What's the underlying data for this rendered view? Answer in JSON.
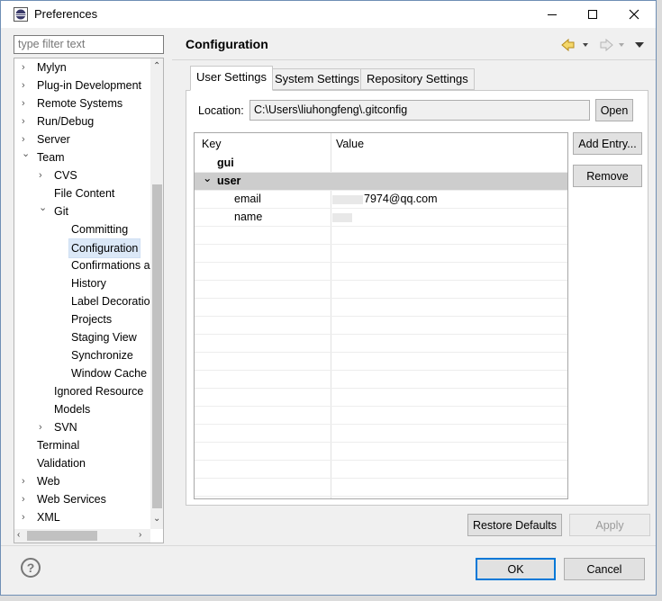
{
  "window": {
    "title": "Preferences"
  },
  "filter": {
    "placeholder": "type filter text"
  },
  "tree": {
    "items": [
      {
        "label": "Mylyn",
        "level": 0,
        "arrow": "collapsed"
      },
      {
        "label": "Plug-in Development",
        "level": 0,
        "arrow": "collapsed"
      },
      {
        "label": "Remote Systems",
        "level": 0,
        "arrow": "collapsed"
      },
      {
        "label": "Run/Debug",
        "level": 0,
        "arrow": "collapsed"
      },
      {
        "label": "Server",
        "level": 0,
        "arrow": "collapsed"
      },
      {
        "label": "Team",
        "level": 0,
        "arrow": "expanded"
      },
      {
        "label": "CVS",
        "level": 1,
        "arrow": "collapsed"
      },
      {
        "label": "File Content",
        "level": 1,
        "arrow": "none"
      },
      {
        "label": "Git",
        "level": 1,
        "arrow": "expanded"
      },
      {
        "label": "Committing",
        "level": 2,
        "arrow": "none"
      },
      {
        "label": "Configuration",
        "level": 2,
        "arrow": "none",
        "selected": true
      },
      {
        "label": "Confirmations a",
        "level": 2,
        "arrow": "none"
      },
      {
        "label": "History",
        "level": 2,
        "arrow": "none"
      },
      {
        "label": "Label Decoratio",
        "level": 2,
        "arrow": "none"
      },
      {
        "label": "Projects",
        "level": 2,
        "arrow": "none"
      },
      {
        "label": "Staging View",
        "level": 2,
        "arrow": "none"
      },
      {
        "label": "Synchronize",
        "level": 2,
        "arrow": "none"
      },
      {
        "label": "Window Cache",
        "level": 2,
        "arrow": "none"
      },
      {
        "label": "Ignored Resource",
        "level": 1,
        "arrow": "none"
      },
      {
        "label": "Models",
        "level": 1,
        "arrow": "none"
      },
      {
        "label": "SVN",
        "level": 1,
        "arrow": "collapsed"
      },
      {
        "label": "Terminal",
        "level": 0,
        "arrow": "none"
      },
      {
        "label": "Validation",
        "level": 0,
        "arrow": "none"
      },
      {
        "label": "Web",
        "level": 0,
        "arrow": "collapsed"
      },
      {
        "label": "Web Services",
        "level": 0,
        "arrow": "collapsed"
      },
      {
        "label": "XML",
        "level": 0,
        "arrow": "collapsed"
      }
    ]
  },
  "page": {
    "title": "Configuration"
  },
  "tabs": [
    {
      "label": "User Settings",
      "active": true
    },
    {
      "label": "System Settings",
      "active": false
    },
    {
      "label": "Repository Settings",
      "active": false
    }
  ],
  "location": {
    "label": "Location:",
    "value": "C:\\Users\\liuhongfeng\\.gitconfig",
    "open_button": "Open"
  },
  "table": {
    "headers": {
      "key": "Key",
      "value": "Value"
    },
    "rows": [
      {
        "key": "gui",
        "value": "",
        "section": true
      },
      {
        "key": "user",
        "value": "",
        "section": true,
        "expanded": true,
        "selected": true
      },
      {
        "key": "email",
        "value": "7974@qq.com",
        "section": false
      },
      {
        "key": "name",
        "value": "",
        "section": false
      }
    ]
  },
  "side_buttons": {
    "add_entry": "Add Entry...",
    "remove": "Remove"
  },
  "page_buttons": {
    "restore_defaults": "Restore Defaults",
    "apply": "Apply"
  },
  "dialog_buttons": {
    "ok": "OK",
    "cancel": "Cancel"
  },
  "colors": {
    "selection": "#dbe8f7",
    "default_button_border": "#0078d7",
    "selected_row": "#cdcdcd"
  }
}
